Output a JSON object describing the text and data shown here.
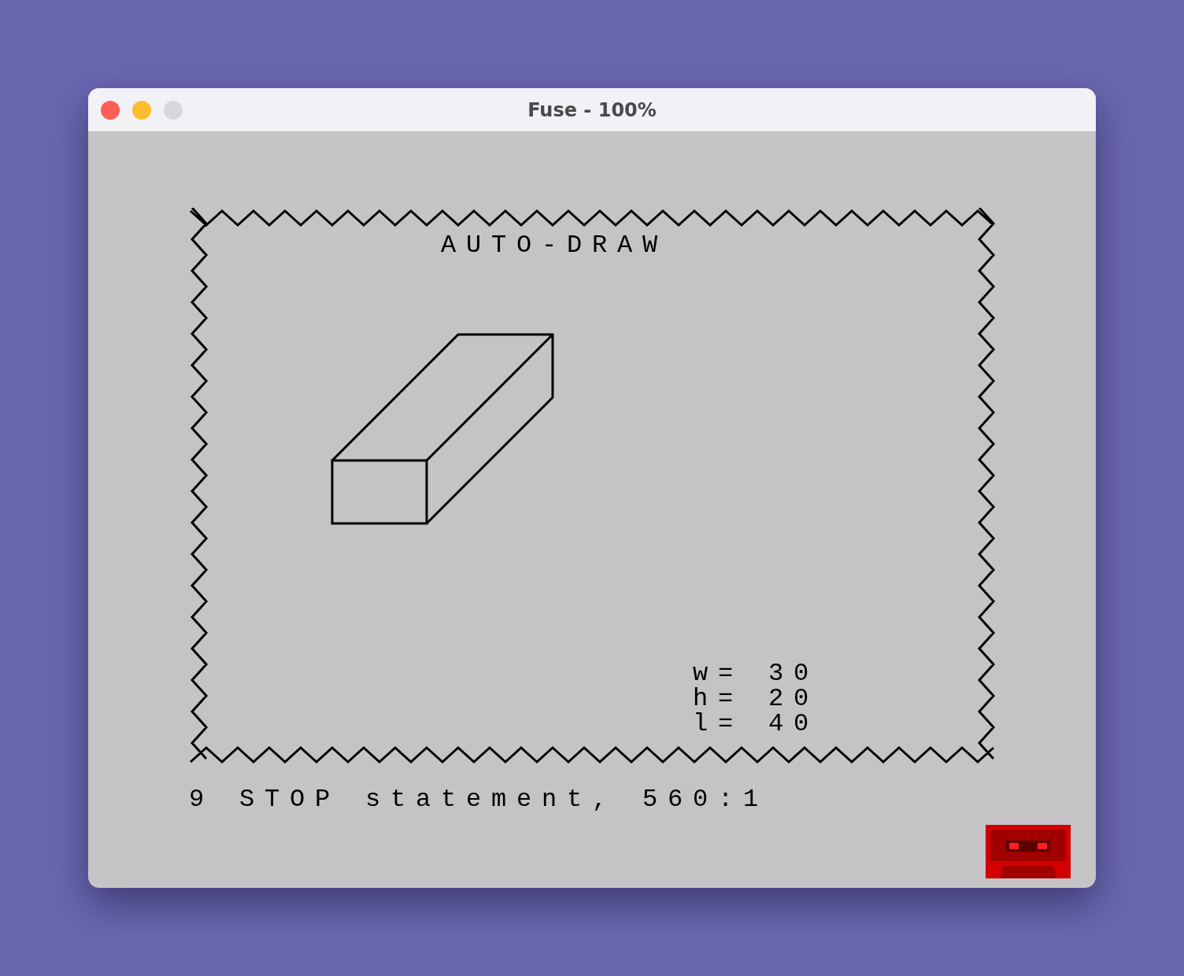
{
  "window": {
    "title": "Fuse - 100%",
    "controls": [
      {
        "kind": "close",
        "disabled": false
      },
      {
        "kind": "minimize",
        "disabled": false
      },
      {
        "kind": "zoom",
        "disabled": true
      }
    ]
  },
  "screen": {
    "title": "AUTO-DRAW",
    "readouts": [
      "w= 30",
      "h= 20",
      "l= 40"
    ],
    "status": "9 STOP statement, 560:1"
  }
}
